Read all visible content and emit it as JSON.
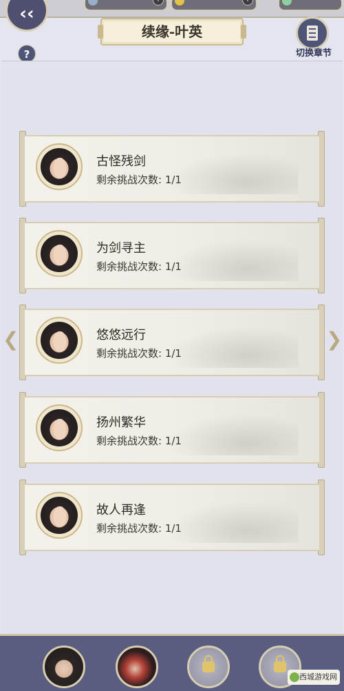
{
  "header": {
    "title": "续缘-叶英",
    "back_icon": "back-arrow-icon",
    "help_label": "?",
    "chapter_switch_label": "切换章节",
    "resources": [
      {
        "icon": "stamina-icon",
        "color": "#9ab0c8"
      },
      {
        "icon": "gold-coin-icon",
        "color": "#e3c24a"
      },
      {
        "icon": "jade-icon",
        "color": "#8ed1a0"
      }
    ]
  },
  "cards": [
    {
      "title": "古怪残剑",
      "attempts": "剩余挑战次数: 1/1"
    },
    {
      "title": "为剑寻主",
      "attempts": "剩余挑战次数: 1/1"
    },
    {
      "title": "悠悠远行",
      "attempts": "剩余挑战次数: 1/1"
    },
    {
      "title": "扬州繁华",
      "attempts": "剩余挑战次数: 1/1"
    },
    {
      "title": "故人再逢",
      "attempts": "剩余挑战次数: 1/1"
    }
  ],
  "navigation": {
    "prev_icon": "chevron-left-icon",
    "next_icon": "chevron-right-icon"
  },
  "bottom_bar": {
    "characters": [
      {
        "name": "character-ye-ying",
        "locked": false
      },
      {
        "name": "character-red-hair",
        "locked": false
      },
      {
        "name": "character-locked-1",
        "locked": true
      },
      {
        "name": "character-locked-2",
        "locked": true
      }
    ]
  },
  "watermark": "西城游戏网"
}
